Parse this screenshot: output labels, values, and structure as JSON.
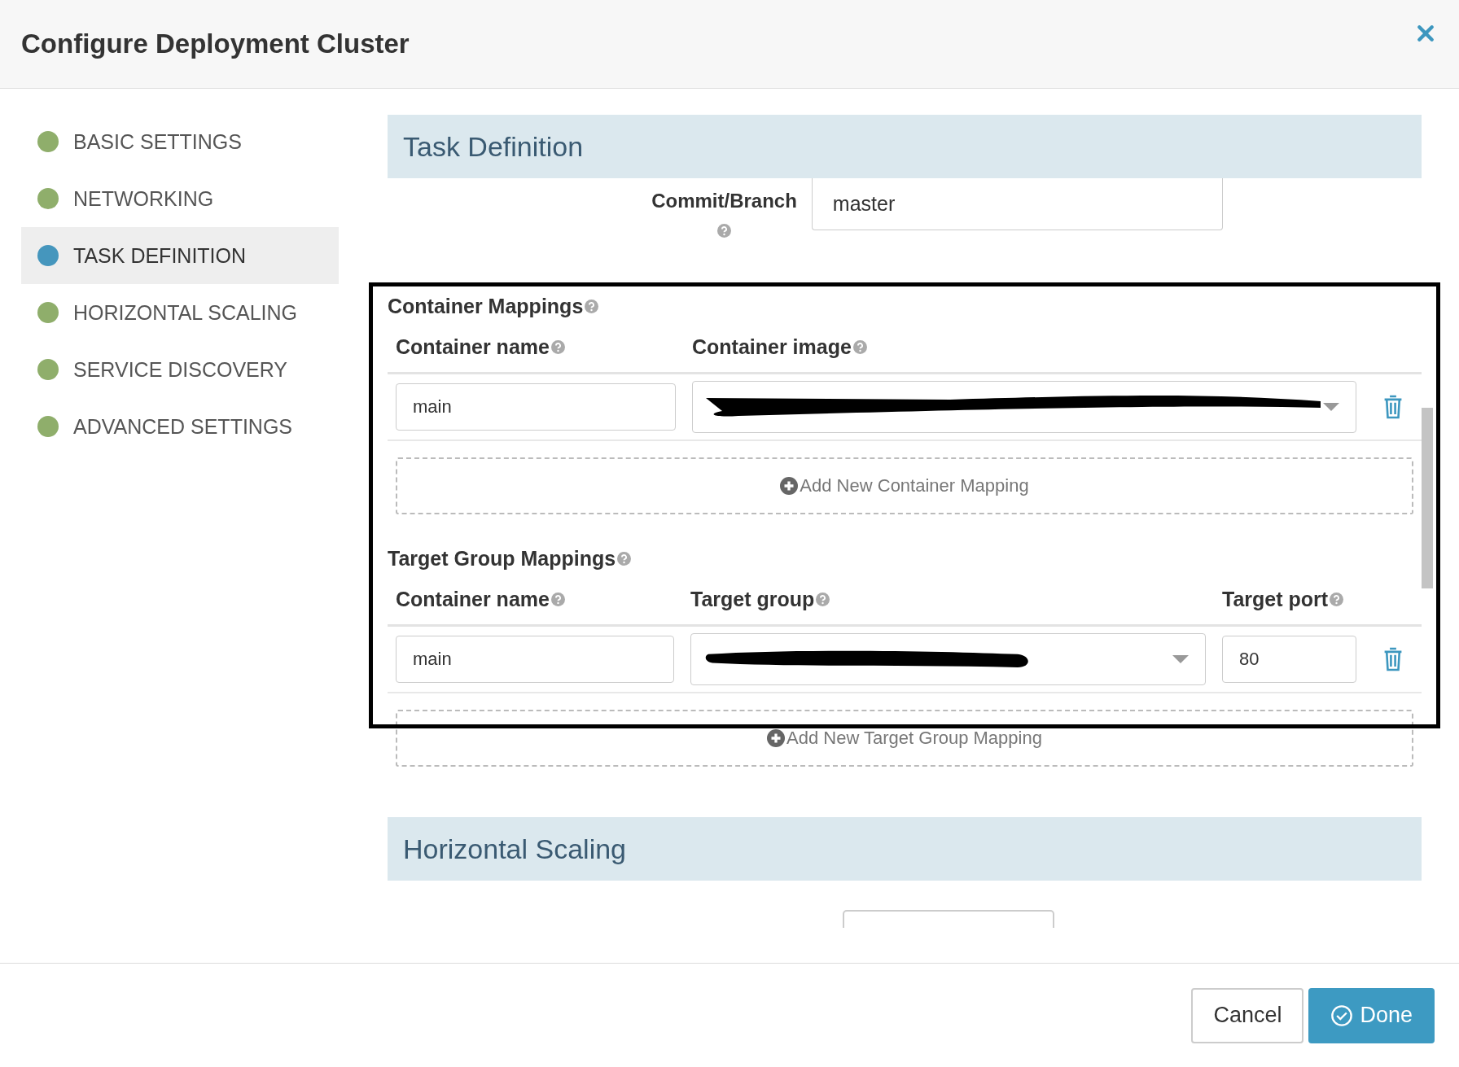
{
  "dialog": {
    "title": "Configure Deployment Cluster"
  },
  "sidebar": {
    "items": [
      {
        "label": "BASIC SETTINGS",
        "selected": false
      },
      {
        "label": "NETWORKING",
        "selected": false
      },
      {
        "label": "TASK DEFINITION",
        "selected": true
      },
      {
        "label": "HORIZONTAL SCALING",
        "selected": false
      },
      {
        "label": "SERVICE DISCOVERY",
        "selected": false
      },
      {
        "label": "ADVANCED SETTINGS",
        "selected": false
      }
    ]
  },
  "task_definition": {
    "title": "Task Definition",
    "commit_branch": {
      "label": "Commit/Branch",
      "value": "master"
    },
    "container_mappings": {
      "title": "Container Mappings",
      "columns": [
        "Container name",
        "Container image"
      ],
      "rows": [
        {
          "container_name": "main"
        }
      ],
      "add_label": "Add New Container Mapping"
    },
    "target_group_mappings": {
      "title": "Target Group Mappings",
      "columns": [
        "Container name",
        "Target group",
        "Target port"
      ],
      "rows": [
        {
          "container_name": "main",
          "target_port": "80"
        }
      ],
      "add_label": "Add New Target Group Mapping"
    }
  },
  "horizontal_scaling": {
    "title": "Horizontal Scaling"
  },
  "footer": {
    "cancel": "Cancel",
    "done": "Done"
  }
}
